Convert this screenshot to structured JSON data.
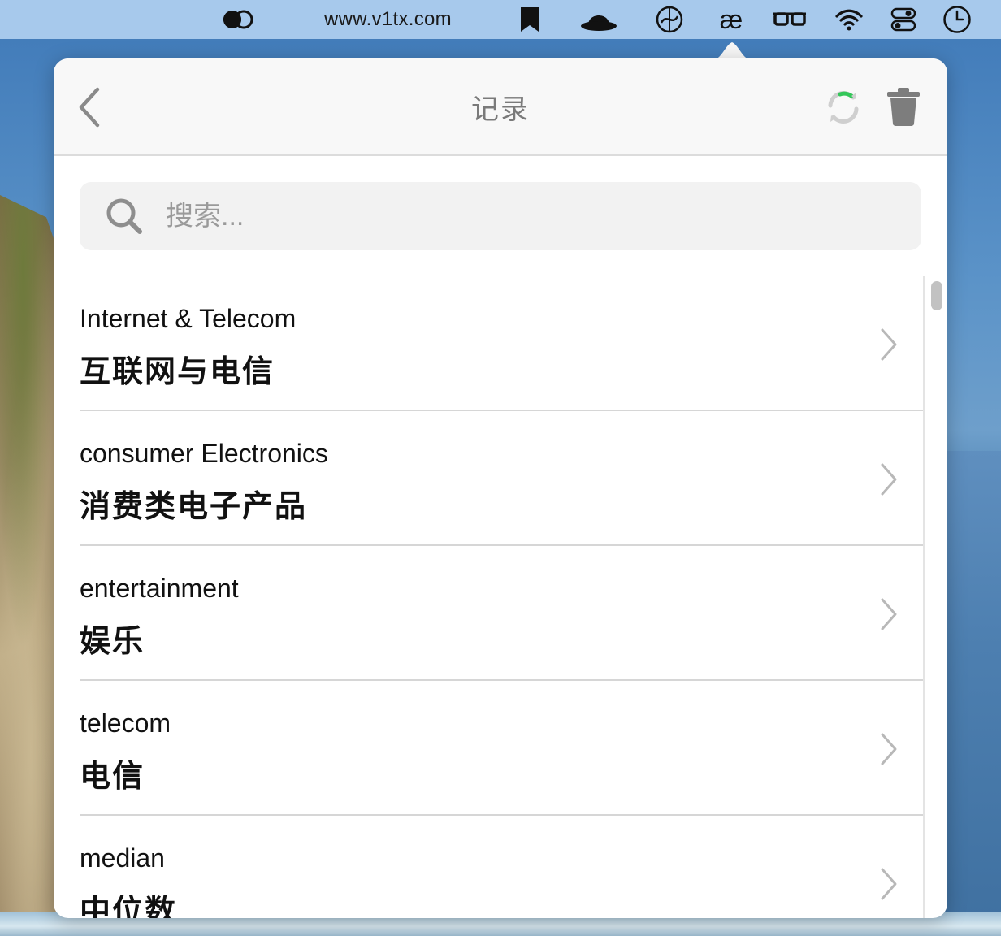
{
  "menubar": {
    "url": "www.v1tx.com",
    "icons": [
      "eclipse-toggle-icon",
      "bookmark-icon",
      "bowler-hat-icon",
      "translate-globe-icon",
      "ae-ligature-icon",
      "glasses-icon",
      "wifi-icon",
      "control-center-icon",
      "clock-icon"
    ],
    "ae_glyph": "æ"
  },
  "header": {
    "title": "记录",
    "back_icon": "chevron-left-icon",
    "sync_icon": "sync-icon",
    "trash_icon": "trash-icon"
  },
  "search": {
    "placeholder": "搜索...",
    "value": ""
  },
  "records": [
    {
      "en": "Internet & Telecom",
      "zh": "互联网与电信"
    },
    {
      "en": "consumer Electronics",
      "zh": "消费类电子产品"
    },
    {
      "en": "entertainment",
      "zh": "娱乐"
    },
    {
      "en": "telecom",
      "zh": "电信"
    },
    {
      "en": "median",
      "zh": "中位数"
    }
  ],
  "colors": {
    "menubar_bg": "#a7c9ec",
    "sync_accent": "#34c759",
    "title_text": "#7a7a7a"
  }
}
